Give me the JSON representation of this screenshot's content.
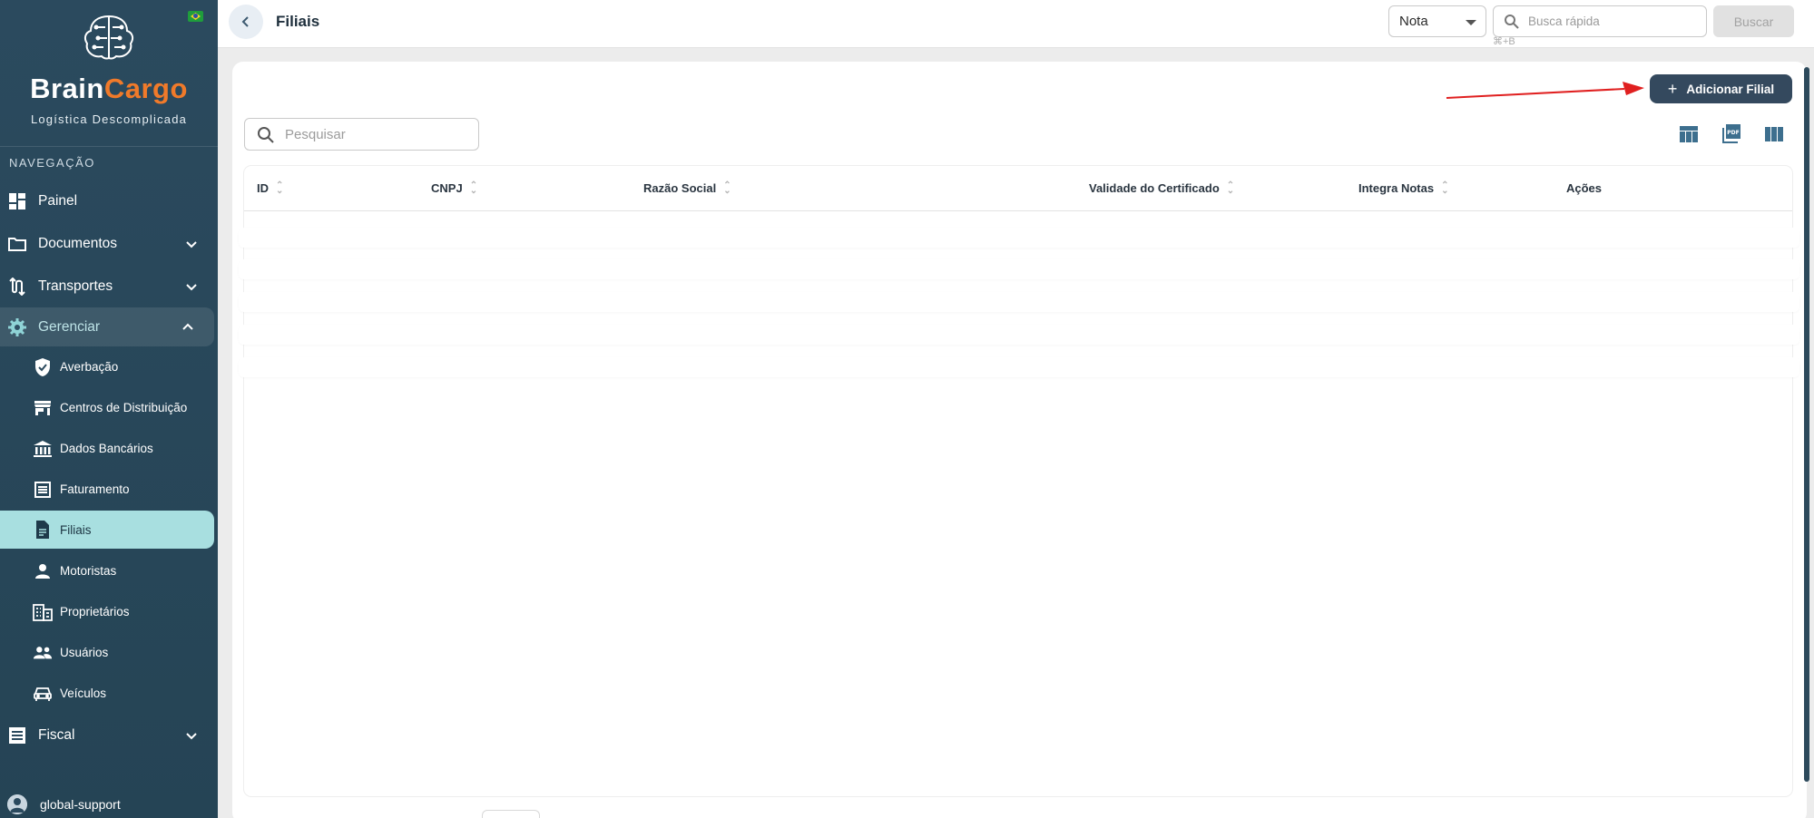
{
  "brand": {
    "name_part1": "Brain",
    "name_part2": "Cargo",
    "tagline": "Logística Descomplicada",
    "colors": {
      "primary": "#2b4a5e",
      "accent": "#f07a2a",
      "active_item": "#a8dfe0"
    }
  },
  "sidebar": {
    "section_label": "NAVEGAÇÃO",
    "items": [
      {
        "label": "Painel",
        "icon": "dashboard-icon"
      },
      {
        "label": "Documentos",
        "icon": "folder-icon",
        "expandable": true
      },
      {
        "label": "Transportes",
        "icon": "route-icon",
        "expandable": true
      },
      {
        "label": "Gerenciar",
        "icon": "gear-icon",
        "expandable": true,
        "expanded": true
      },
      {
        "label": "Fiscal",
        "icon": "document-list-icon",
        "expandable": true
      }
    ],
    "sub_items": [
      {
        "label": "Averbação",
        "icon": "shield-check-icon"
      },
      {
        "label": "Centros de Distribuição",
        "icon": "store-icon"
      },
      {
        "label": "Dados Bancários",
        "icon": "bank-icon"
      },
      {
        "label": "Faturamento",
        "icon": "list-icon"
      },
      {
        "label": "Filiais",
        "icon": "file-icon",
        "active": true
      },
      {
        "label": "Motoristas",
        "icon": "person-icon"
      },
      {
        "label": "Proprietários",
        "icon": "building-icon"
      },
      {
        "label": "Usuários",
        "icon": "group-icon"
      },
      {
        "label": "Veículos",
        "icon": "car-icon"
      }
    ],
    "user": {
      "name": "global-support"
    }
  },
  "topbar": {
    "title": "Filiais",
    "select_value": "Nota",
    "quick_search_placeholder": "Busca rápida",
    "shortcut_hint": "⌘+B",
    "search_button": "Buscar"
  },
  "toolbar": {
    "add_button": "Adicionar Filial",
    "search_placeholder": "Pesquisar",
    "icons": [
      "table-view-icon",
      "pdf-export-icon",
      "columns-icon"
    ]
  },
  "table": {
    "columns": [
      "ID",
      "CNPJ",
      "Razão Social",
      "Validade do Certificado",
      "Integra Notas",
      "Ações"
    ],
    "rows": []
  }
}
